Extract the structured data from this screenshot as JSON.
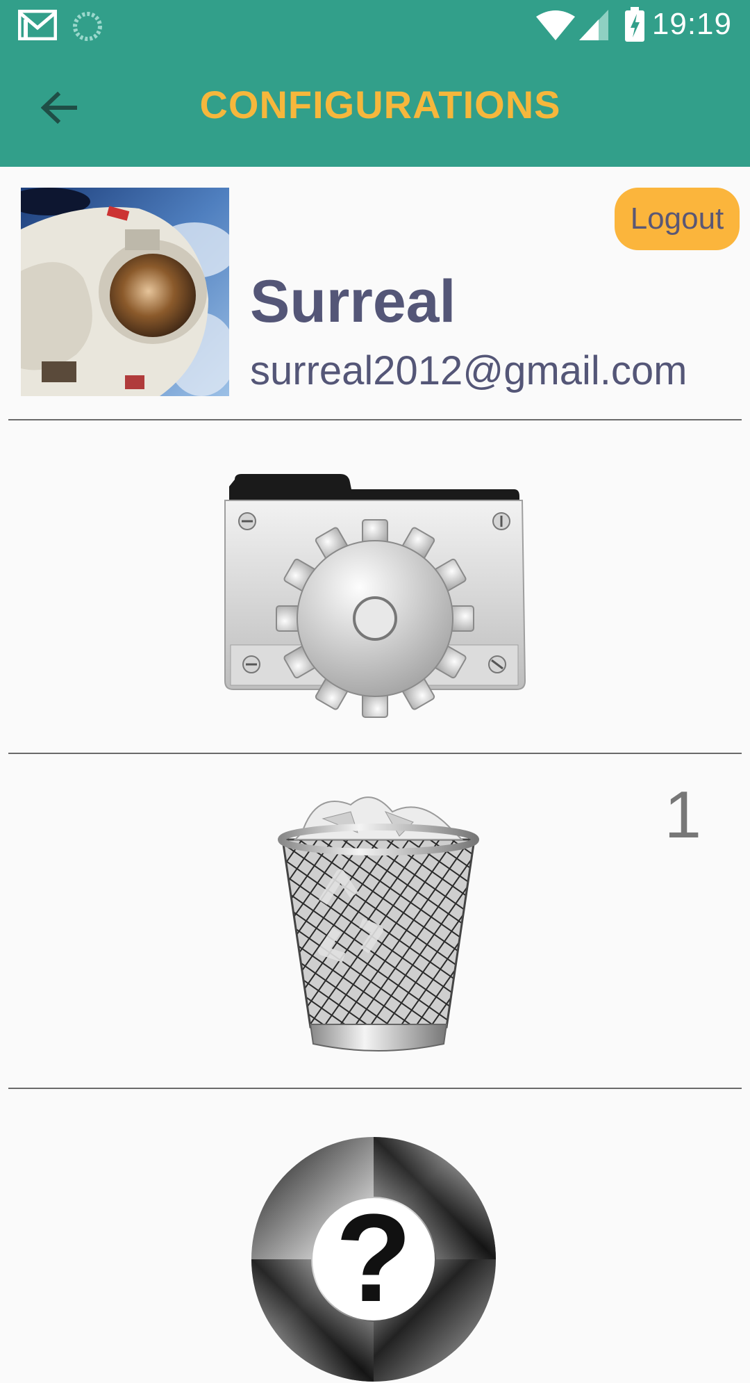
{
  "status_bar": {
    "time": "19:19"
  },
  "app_bar": {
    "title": "CONFIGURATIONS",
    "back_icon": "arrow-left-icon"
  },
  "profile": {
    "name": "Surreal",
    "email": "surreal2012@gmail.com",
    "logout_label": "Logout"
  },
  "menu": {
    "settings_icon": "settings-folder-icon",
    "trash_icon": "trash-bin-icon",
    "trash_count": "1",
    "help_icon": "help-icon"
  },
  "colors": {
    "primary": "#329f8a",
    "accent": "#f6b73c",
    "text": "#545677",
    "background": "#fafafa"
  }
}
